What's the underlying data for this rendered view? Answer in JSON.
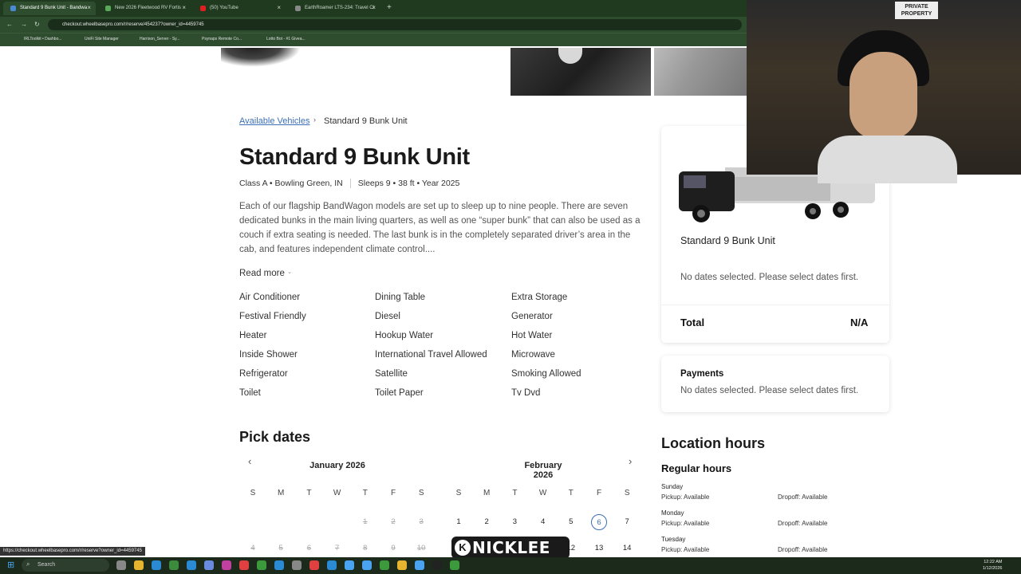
{
  "browser": {
    "tabs": [
      {
        "title": "Standard 9 Bunk Unit - Bandwa",
        "active": true,
        "fav_color": "#4a8ad4"
      },
      {
        "title": "New 2026 Fleetwood RV Fortis",
        "active": false,
        "fav_color": "#5aa85a"
      },
      {
        "title": "(50) YouTube",
        "active": false,
        "fav_color": "#e02020"
      },
      {
        "title": "EarthRoamer LTS-234: Travel Cl",
        "active": false,
        "fav_color": "#888888"
      }
    ],
    "new_tab": "+",
    "url": "checkout.wheelbasepro.com/r/reserve/454237?owner_id=4459745",
    "bookmarks": [
      "IRLToolkit • Dashbo...",
      "UniFi Site Manager",
      "Harrison_Server - Sy...",
      "Psynaps Remote Co...",
      "Lotto Bot - #1 Givea..."
    ]
  },
  "breadcrumb": {
    "link": "Available Vehicles",
    "separator": "›",
    "current": "Standard 9 Bunk Unit"
  },
  "listing": {
    "title": "Standard 9 Bunk Unit",
    "meta_left": "Class A • Bowling Green, IN",
    "meta_right": "Sleeps 9 • 38 ft • Year 2025",
    "description": "Each of our flagship BandWagon models are set up to sleep up to nine people. There are seven dedicated bunks in the main living quarters, as well as one “super bunk” that can also be used as a couch if extra seating is needed. The last bunk is in the completely separated driver’s area in the cab, and features independent climate control....",
    "read_more": "Read more",
    "read_more_icon": "chevron-down-icon",
    "amenities": [
      "Air Conditioner",
      "Dining Table",
      "Extra Storage",
      "Festival Friendly",
      "Diesel",
      "Generator",
      "Heater",
      "Hookup Water",
      "Hot Water",
      "Inside Shower",
      "International Travel Allowed",
      "Microwave",
      "Refrigerator",
      "Satellite",
      "Smoking Allowed",
      "Toilet",
      "Toilet Paper",
      "Tv Dvd"
    ]
  },
  "calendar": {
    "heading": "Pick dates",
    "prev": "‹",
    "next": "›",
    "months": [
      {
        "label": "January 2026",
        "dow": [
          "S",
          "M",
          "T",
          "W",
          "T",
          "F",
          "S"
        ],
        "row1": [
          "",
          "",
          "",
          "",
          "1",
          "2",
          "3"
        ],
        "row2": [
          "4",
          "5",
          "6",
          "7",
          "8",
          "9",
          "10"
        ]
      },
      {
        "label": "February 2026",
        "dow": [
          "S",
          "M",
          "T",
          "W",
          "T",
          "F",
          "S"
        ],
        "row1": [
          "1",
          "2",
          "3",
          "4",
          "5",
          "6",
          "7"
        ],
        "row2": [
          "8",
          "9",
          "10",
          "11",
          "12",
          "13",
          "14"
        ]
      }
    ],
    "selected_day": "6"
  },
  "summary": {
    "vehicle_name": "Standard 9 Bunk Unit",
    "no_dates": "No dates selected. Please select dates first.",
    "total_label": "Total",
    "total_value": "N/A"
  },
  "payments": {
    "title": "Payments",
    "text": "No dates selected. Please select dates first."
  },
  "location_hours": {
    "title": "Location hours",
    "regular_title": "Regular hours",
    "days": [
      {
        "day": "Sunday",
        "pickup": "Pickup: Available",
        "dropoff": "Dropoff: Available"
      },
      {
        "day": "Monday",
        "pickup": "Pickup: Available",
        "dropoff": "Dropoff: Available"
      },
      {
        "day": "Tuesday",
        "pickup": "Pickup: Available",
        "dropoff": "Dropoff: Available"
      }
    ]
  },
  "webcam": {
    "sign_text": "PRIVATE PROPERTY"
  },
  "overlay": {
    "logo_letter": "K",
    "logo_text": "NICKLEE"
  },
  "status_url": "https://checkout.wheelbasepro.com/r/reserve?owner_id=4459745",
  "taskbar": {
    "search_placeholder": "Search",
    "time": "12:22 AM",
    "date": "1/12/2026"
  }
}
